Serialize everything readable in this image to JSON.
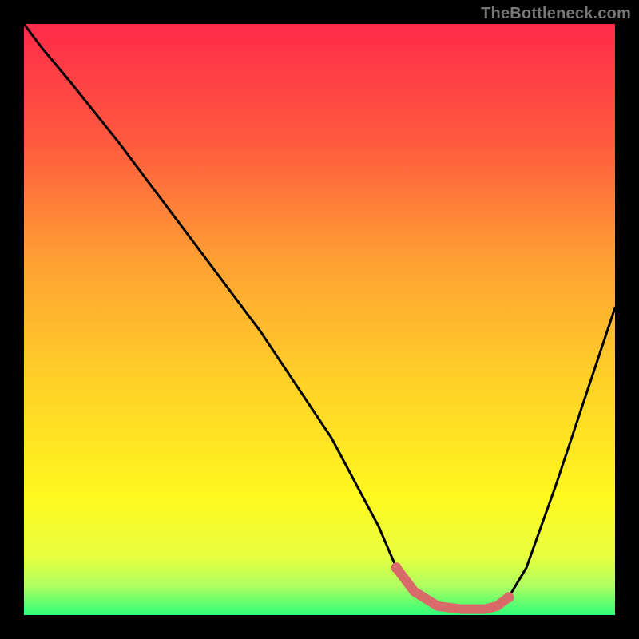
{
  "watermark": {
    "text": "TheBottleneck.com"
  },
  "gradient": {
    "stops": [
      {
        "offset": 0.0,
        "color": "#ff2b4a"
      },
      {
        "offset": 0.2,
        "color": "#ff5a3f"
      },
      {
        "offset": 0.4,
        "color": "#ffa033"
      },
      {
        "offset": 0.6,
        "color": "#ffd028"
      },
      {
        "offset": 0.8,
        "color": "#fff81f"
      },
      {
        "offset": 0.9,
        "color": "#e8ff40"
      },
      {
        "offset": 0.95,
        "color": "#b0ff60"
      },
      {
        "offset": 1.0,
        "color": "#2eff7a"
      }
    ]
  },
  "chart_data": {
    "type": "line",
    "title": "",
    "xlabel": "",
    "ylabel": "",
    "xlim": [
      0,
      1
    ],
    "ylim": [
      0,
      1
    ],
    "series": [
      {
        "name": "bottleneck-curve",
        "x": [
          0.0,
          0.03,
          0.08,
          0.16,
          0.28,
          0.4,
          0.52,
          0.6,
          0.63,
          0.66,
          0.7,
          0.74,
          0.78,
          0.8,
          0.82,
          0.85,
          0.9,
          0.95,
          1.0
        ],
        "values": [
          1.0,
          0.96,
          0.9,
          0.8,
          0.64,
          0.48,
          0.3,
          0.15,
          0.08,
          0.04,
          0.015,
          0.01,
          0.01,
          0.015,
          0.03,
          0.08,
          0.22,
          0.37,
          0.52
        ],
        "color": "#000000",
        "width": 3
      },
      {
        "name": "bottom-highlight",
        "x": [
          0.63,
          0.66,
          0.7,
          0.74,
          0.78,
          0.8,
          0.82
        ],
        "values": [
          0.08,
          0.04,
          0.015,
          0.01,
          0.01,
          0.015,
          0.03
        ],
        "color": "#d96a6a",
        "width": 12,
        "endpoints": true
      }
    ]
  }
}
